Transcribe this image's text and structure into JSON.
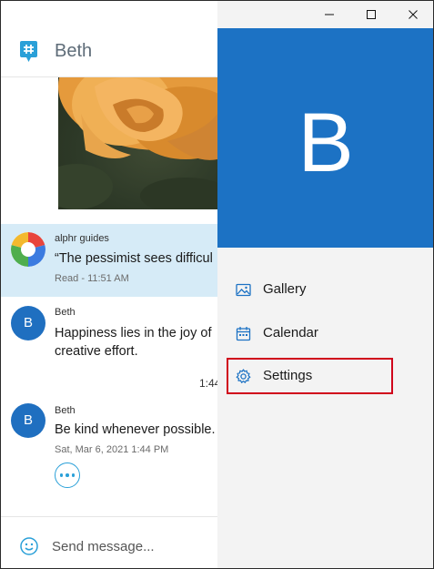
{
  "chat": {
    "contact_name": "Beth",
    "messages": [
      {
        "sender": "alphr guides",
        "text": "“The pessimist sees difficul",
        "meta": "Read - 11:51 AM"
      },
      {
        "sender": "Beth",
        "avatar_initial": "B",
        "text_lines": [
          "Happiness lies in the joy of",
          "creative effort."
        ],
        "time_clipped": "1:44"
      },
      {
        "sender": "Beth",
        "avatar_initial": "B",
        "text": "Be kind whenever possible.",
        "meta": "Sat, Mar 6, 2021 1:44 PM"
      }
    ],
    "composer": {
      "placeholder": "Send message..."
    }
  },
  "panel": {
    "profile_initial": "B",
    "menu": [
      {
        "label": "Gallery",
        "icon": "gallery-icon"
      },
      {
        "label": "Calendar",
        "icon": "calendar-icon"
      },
      {
        "label": "Settings",
        "icon": "gear-icon",
        "selected": true
      }
    ]
  },
  "colors": {
    "accent_blue": "#1c72c4",
    "highlight_bg": "#d6ebf7",
    "selection_outline": "#d0021b",
    "icon_teal": "#2aa0d8"
  }
}
